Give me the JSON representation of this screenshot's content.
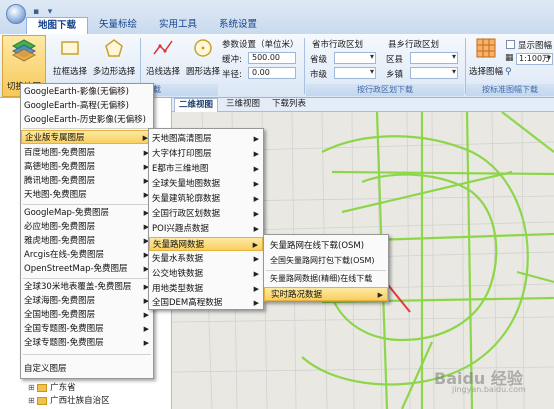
{
  "tabs": [
    "地图下载",
    "矢量标绘",
    "实用工具",
    "系统设置"
  ],
  "ribbon": {
    "switch_map": "切换地图",
    "box_select": "拉框选择",
    "polygon_select": "多边形选择",
    "line_select": "沿线选择",
    "circle_select": "圆形选择",
    "group_shape": "按形选范围下载",
    "param_title": "参数设置（单位米）",
    "buffer_label": "缓冲:",
    "buffer_value": "500.00",
    "radius_label": "半径:",
    "radius_value": "0.00",
    "city_group": "省市行政区划",
    "province_label": "省级",
    "city_label": "市级",
    "county_group": "县乡行政区划",
    "district_label": "区县",
    "town_label": "乡镇",
    "group_admin": "按行政区划下载",
    "select_sheet": "选择图幅",
    "show_sheet": "显示图幅",
    "scale_value": "1:100万",
    "group_sheet": "按标准图幅下载"
  },
  "map_tabs": [
    "二维视图",
    "三维视图",
    "下载列表"
  ],
  "menu1": {
    "items": [
      {
        "label": "GoogleEarth-影像(无偏移)",
        "arrow": false
      },
      {
        "label": "GoogleEarth-高程(无偏移)",
        "arrow": false
      },
      {
        "label": "GoogleEarth-历史影像(无偏移)",
        "arrow": false
      },
      {
        "label": "企业版专属图层",
        "arrow": true
      },
      {
        "label": "百度地图-免费图层",
        "arrow": true
      },
      {
        "label": "高德地图-免费图层",
        "arrow": true
      },
      {
        "label": "腾讯地图-免费图层",
        "arrow": true
      },
      {
        "label": "天地图-免费图层",
        "arrow": true
      },
      {
        "label": "GoogleMap-免费图层",
        "arrow": true
      },
      {
        "label": "必应地图-免费图层",
        "arrow": true
      },
      {
        "label": "雅虎地图-免费图层",
        "arrow": true
      },
      {
        "label": "Arcgis在线-免费图层",
        "arrow": true
      },
      {
        "label": "OpenStreetMap-免费图层",
        "arrow": true
      },
      {
        "label": "全球30米地表覆盖-免费图层",
        "arrow": true
      },
      {
        "label": "全球海图-免费图层",
        "arrow": true
      },
      {
        "label": "全国地图-免费图层",
        "arrow": true
      },
      {
        "label": "全国专题图-免费图层",
        "arrow": true
      },
      {
        "label": "全球专题图-免费图层",
        "arrow": true
      },
      {
        "label": "自定义图层",
        "arrow": false
      }
    ]
  },
  "menu2": {
    "items": [
      {
        "label": "天地图高清图层",
        "arrow": true
      },
      {
        "label": "大字体打印图层",
        "arrow": true
      },
      {
        "label": "E都市三维地图",
        "arrow": true
      },
      {
        "label": "全球矢量地图数据",
        "arrow": true
      },
      {
        "label": "矢量建筑轮廓数据",
        "arrow": true
      },
      {
        "label": "全国行政区划数据",
        "arrow": true
      },
      {
        "label": "POI兴趣点数据",
        "arrow": true
      },
      {
        "label": "矢量路网数据",
        "arrow": true
      },
      {
        "label": "矢量水系数据",
        "arrow": true
      },
      {
        "label": "公交地铁数据",
        "arrow": true
      },
      {
        "label": "用地类型数据",
        "arrow": true
      },
      {
        "label": "全国DEM高程数据",
        "arrow": true
      }
    ]
  },
  "menu3": {
    "items": [
      {
        "label": "矢量路网在线下载(OSM)",
        "arrow": false
      },
      {
        "label": "全国矢量路网打包下载(OSM)",
        "arrow": false
      },
      {
        "label": "矢量路网数据(精细)在线下载",
        "arrow": false
      },
      {
        "label": "实时路况数据",
        "arrow": true
      }
    ]
  },
  "tree": [
    "广东省",
    "广西壮族自治区"
  ],
  "watermark": "Baidu 经验",
  "watermark_url": "jingyan.baidu.com",
  "colors": {
    "road_major": "#8dd64a",
    "road_minor": "#cfcfcf",
    "highlight": "#f9cf5f",
    "arrow": "#e03b3b"
  }
}
